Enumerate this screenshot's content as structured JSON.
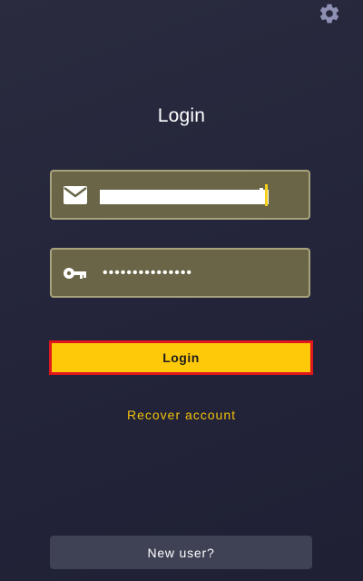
{
  "settings": {
    "icon": "gear-icon"
  },
  "title": "Login",
  "email_field": {
    "icon": "email-icon",
    "value": "",
    "placeholder": ""
  },
  "password_field": {
    "icon": "key-icon",
    "value": "•••••••••••••••"
  },
  "login_button": {
    "label": "Login"
  },
  "recover_link": {
    "label": "Recover account"
  },
  "new_user_button": {
    "label": "New user?"
  },
  "colors": {
    "background": "#24253a",
    "field_fill": "#6a6547",
    "field_border": "#a8a27c",
    "accent_yellow": "#fec909",
    "focus_red": "#e0171d",
    "link_yellow": "#f2c10a",
    "secondary_button": "#3f4155"
  }
}
